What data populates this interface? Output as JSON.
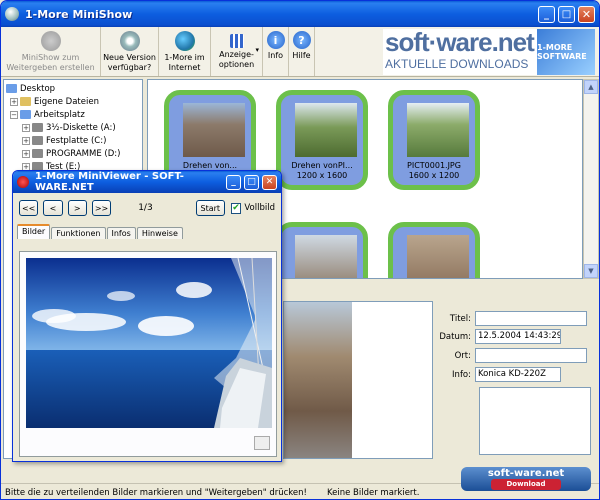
{
  "window": {
    "title": "1-More MiniShow"
  },
  "toolbar": {
    "buttons": [
      {
        "label": "MiniShow zum Weitergeben erstellen",
        "icon": "people-icon",
        "enabled": false
      },
      {
        "label": "Neue Version verfügbar?",
        "icon": "cd-icon",
        "enabled": true
      },
      {
        "label": "1-More im Internet",
        "icon": "globe-icon",
        "enabled": true
      },
      {
        "label": "Anzeige-optionen",
        "icon": "grid-icon",
        "enabled": true
      },
      {
        "label": "Info",
        "icon": "info-icon",
        "enabled": true
      },
      {
        "label": "Hilfe",
        "icon": "help-icon",
        "enabled": true
      }
    ]
  },
  "logo": {
    "text": "soft·ware.net",
    "subtitle": "AKTUELLE DOWNLOADS",
    "badge": "1-MORE SOFTWARE"
  },
  "tree": {
    "items": [
      {
        "label": "Desktop",
        "level": 0,
        "expander": ""
      },
      {
        "label": "Eigene Dateien",
        "level": 1,
        "expander": "+"
      },
      {
        "label": "Arbeitsplatz",
        "level": 1,
        "expander": "−"
      },
      {
        "label": "3½-Diskette (A:)",
        "level": 2,
        "expander": "+"
      },
      {
        "label": "Festplatte (C:)",
        "level": 2,
        "expander": "+"
      },
      {
        "label": "PROGRAMME (D:)",
        "level": 2,
        "expander": "+"
      },
      {
        "label": "Test (E:)",
        "level": 2,
        "expander": "+"
      }
    ]
  },
  "thumbnails": [
    {
      "name": "Drehen von...",
      "size": ""
    },
    {
      "name": "Drehen vonPI...",
      "size": "1200 x 1600"
    },
    {
      "name": "PICT0001.JPG",
      "size": "1600 x 1200"
    }
  ],
  "properties": {
    "titel_label": "Titel:",
    "titel_value": "",
    "datum_label": "Datum:",
    "datum_value": "12.5.2004  14:43:29",
    "ort_label": "Ort:",
    "ort_value": "",
    "info_label": "Info:",
    "info_value": "Konica KD-220Z"
  },
  "status": {
    "left": "Bitte die zu verteilenden Bilder markieren und \"Weitergeben\" drücken!",
    "right": "Keine Bilder markiert."
  },
  "watermark": {
    "text": "soft-ware.net",
    "sub": "Download"
  },
  "miniviewer": {
    "title": "1-More MiniViewer - SOFT-WARE.NET",
    "nav": {
      "first": "<<",
      "prev": "<",
      "next": ">",
      "last": ">>"
    },
    "counter": "1/3",
    "start_label": "Start",
    "fullscreen_label": "Vollbild",
    "fullscreen_checked": true,
    "tabs": [
      "Bilder",
      "Funktionen",
      "Infos",
      "Hinweise"
    ]
  }
}
